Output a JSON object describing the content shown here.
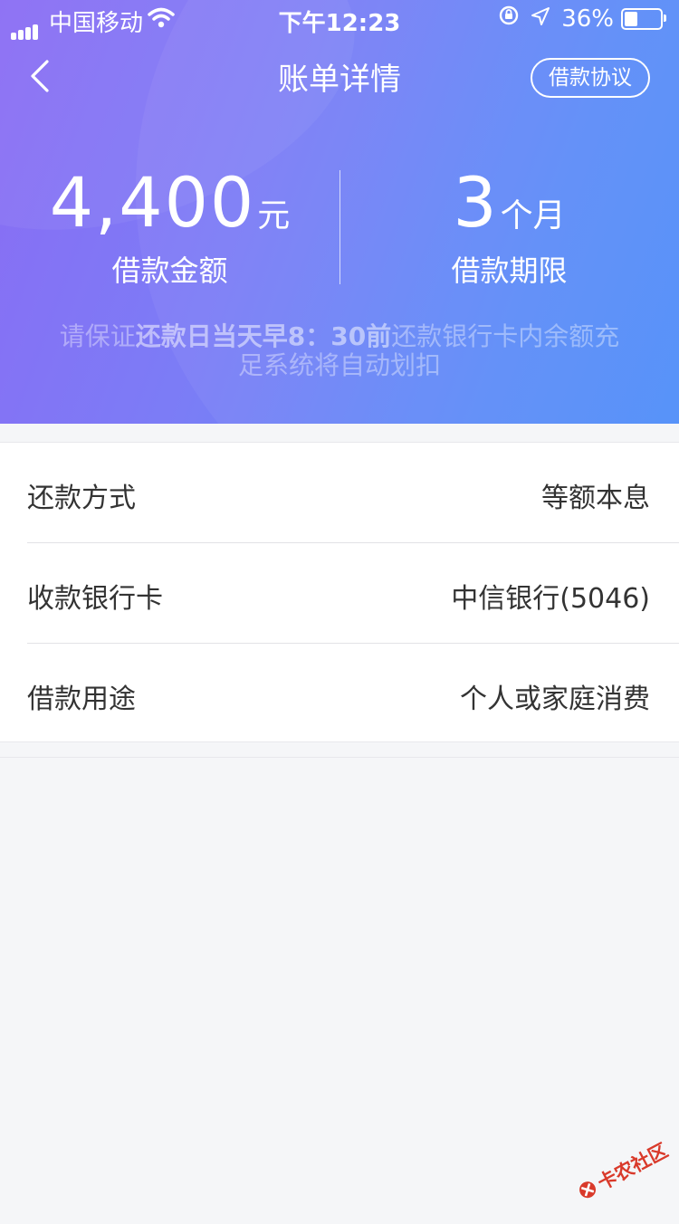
{
  "status_bar": {
    "carrier": "中国移动",
    "time": "下午12:23",
    "battery_percent": "36%",
    "battery_level": 0.36,
    "icons": [
      "signal-icon",
      "wifi-icon",
      "rotation-lock-icon",
      "location-icon",
      "battery-icon"
    ]
  },
  "nav": {
    "back_icon": "chevron-left-icon",
    "title": "账单详情",
    "agreement_label": "借款协议"
  },
  "summary": {
    "amount_value": "4,400",
    "amount_unit": "元",
    "amount_label": "借款金额",
    "term_value": "3",
    "term_unit": "个月",
    "term_label": "借款期限"
  },
  "notice": {
    "prefix": "请保证",
    "bold": "还款日当天早8：30前",
    "suffix": "还款银行卡内余额充足系统将自动划扣"
  },
  "details": {
    "rows": [
      {
        "key": "还款方式",
        "value": "等额本息"
      },
      {
        "key": "收款银行卡",
        "value": "中信银行(5046)"
      },
      {
        "key": "借款用途",
        "value": "个人或家庭消费"
      }
    ]
  },
  "watermark": {
    "text": "卡农社区"
  },
  "colors": {
    "gradient_start": "#8a6cf4",
    "gradient_end": "#4f8ef9",
    "page_bg": "#f5f6f8",
    "text_primary": "#333333"
  }
}
